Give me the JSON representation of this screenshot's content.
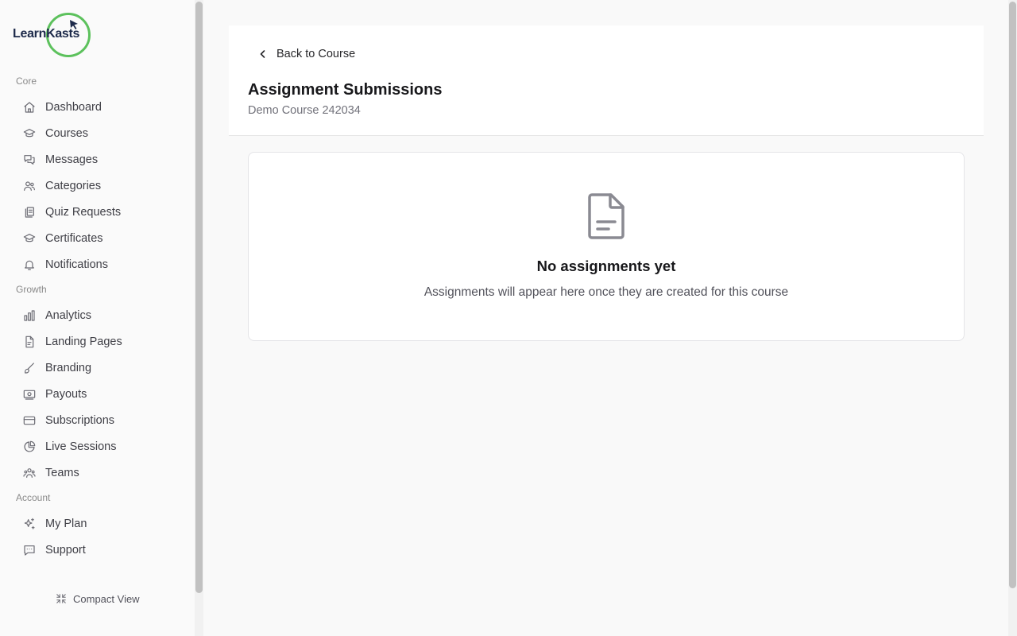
{
  "brand": {
    "name": "LearnKasts",
    "ring_color": "#5cc15c",
    "text_color": "#1d2a4a"
  },
  "sidebar": {
    "sections": [
      {
        "label": "Core",
        "items": [
          {
            "label": "Dashboard",
            "icon": "home-icon"
          },
          {
            "label": "Courses",
            "icon": "graduation-cap-icon"
          },
          {
            "label": "Messages",
            "icon": "messages-icon"
          },
          {
            "label": "Categories",
            "icon": "users-icon"
          },
          {
            "label": "Quiz Requests",
            "icon": "clipboard-copy-icon"
          },
          {
            "label": "Certificates",
            "icon": "graduation-cap-icon"
          },
          {
            "label": "Notifications",
            "icon": "bell-icon"
          }
        ]
      },
      {
        "label": "Growth",
        "items": [
          {
            "label": "Analytics",
            "icon": "bar-chart-icon"
          },
          {
            "label": "Landing Pages",
            "icon": "file-text-icon"
          },
          {
            "label": "Branding",
            "icon": "brush-icon"
          },
          {
            "label": "Payouts",
            "icon": "banknote-icon"
          },
          {
            "label": "Subscriptions",
            "icon": "credit-card-icon"
          },
          {
            "label": "Live Sessions",
            "icon": "pie-chart-icon"
          },
          {
            "label": "Teams",
            "icon": "team-icon"
          }
        ]
      },
      {
        "label": "Account",
        "items": [
          {
            "label": "My Plan",
            "icon": "sparkles-icon"
          },
          {
            "label": "Support",
            "icon": "message-square-icon"
          }
        ]
      }
    ],
    "compact_view_label": "Compact View"
  },
  "header": {
    "back_label": "Back to Course",
    "title": "Assignment Submissions",
    "subtitle": "Demo Course 242034"
  },
  "empty_state": {
    "icon": "file-icon",
    "title": "No assignments yet",
    "description": "Assignments will appear here once they are created for this course"
  }
}
